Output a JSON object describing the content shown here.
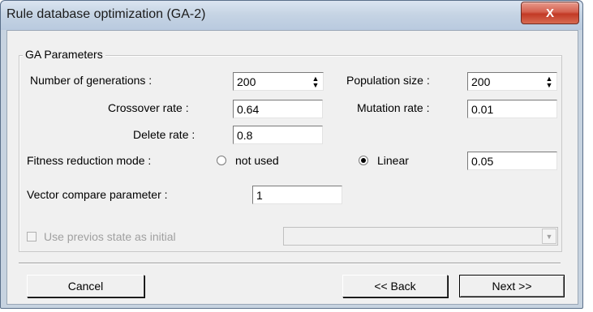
{
  "window": {
    "title": "Rule database optimization (GA-2)",
    "close_label": "X"
  },
  "group": {
    "legend": "GA Parameters"
  },
  "params": {
    "generations_label": "Number of generations :",
    "generations_value": "200",
    "population_label": "Population size :",
    "population_value": "200",
    "crossover_label": "Crossover rate :",
    "crossover_value": "0.64",
    "mutation_label": "Mutation rate :",
    "mutation_value": "0.01",
    "delete_label": "Delete rate :",
    "delete_value": "0.8",
    "fitness_label": "Fitness reduction mode :",
    "fitness_option_not_used": "not used",
    "fitness_option_linear": "Linear",
    "fitness_selected": "Linear",
    "linear_value": "0.05",
    "vector_label": "Vector compare parameter :",
    "vector_value": "1"
  },
  "initial_state": {
    "checkbox_label": "Use previos state as initial",
    "checked": false,
    "enabled": false,
    "combo_value": ""
  },
  "buttons": {
    "cancel": "Cancel",
    "back": "<< Back",
    "next": "Next >>"
  },
  "icons": {
    "spin_up": "▲",
    "spin_down": "▼",
    "dropdown": "▼"
  }
}
